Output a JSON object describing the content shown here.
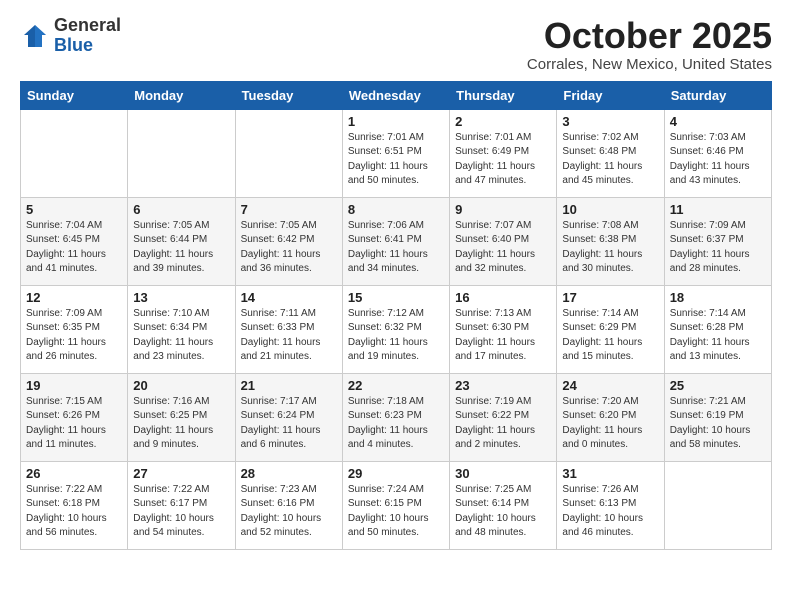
{
  "logo": {
    "general": "General",
    "blue": "Blue"
  },
  "header": {
    "month": "October 2025",
    "location": "Corrales, New Mexico, United States"
  },
  "weekdays": [
    "Sunday",
    "Monday",
    "Tuesday",
    "Wednesday",
    "Thursday",
    "Friday",
    "Saturday"
  ],
  "weeks": [
    [
      {
        "day": "",
        "info": ""
      },
      {
        "day": "",
        "info": ""
      },
      {
        "day": "",
        "info": ""
      },
      {
        "day": "1",
        "info": "Sunrise: 7:01 AM\nSunset: 6:51 PM\nDaylight: 11 hours\nand 50 minutes."
      },
      {
        "day": "2",
        "info": "Sunrise: 7:01 AM\nSunset: 6:49 PM\nDaylight: 11 hours\nand 47 minutes."
      },
      {
        "day": "3",
        "info": "Sunrise: 7:02 AM\nSunset: 6:48 PM\nDaylight: 11 hours\nand 45 minutes."
      },
      {
        "day": "4",
        "info": "Sunrise: 7:03 AM\nSunset: 6:46 PM\nDaylight: 11 hours\nand 43 minutes."
      }
    ],
    [
      {
        "day": "5",
        "info": "Sunrise: 7:04 AM\nSunset: 6:45 PM\nDaylight: 11 hours\nand 41 minutes."
      },
      {
        "day": "6",
        "info": "Sunrise: 7:05 AM\nSunset: 6:44 PM\nDaylight: 11 hours\nand 39 minutes."
      },
      {
        "day": "7",
        "info": "Sunrise: 7:05 AM\nSunset: 6:42 PM\nDaylight: 11 hours\nand 36 minutes."
      },
      {
        "day": "8",
        "info": "Sunrise: 7:06 AM\nSunset: 6:41 PM\nDaylight: 11 hours\nand 34 minutes."
      },
      {
        "day": "9",
        "info": "Sunrise: 7:07 AM\nSunset: 6:40 PM\nDaylight: 11 hours\nand 32 minutes."
      },
      {
        "day": "10",
        "info": "Sunrise: 7:08 AM\nSunset: 6:38 PM\nDaylight: 11 hours\nand 30 minutes."
      },
      {
        "day": "11",
        "info": "Sunrise: 7:09 AM\nSunset: 6:37 PM\nDaylight: 11 hours\nand 28 minutes."
      }
    ],
    [
      {
        "day": "12",
        "info": "Sunrise: 7:09 AM\nSunset: 6:35 PM\nDaylight: 11 hours\nand 26 minutes."
      },
      {
        "day": "13",
        "info": "Sunrise: 7:10 AM\nSunset: 6:34 PM\nDaylight: 11 hours\nand 23 minutes."
      },
      {
        "day": "14",
        "info": "Sunrise: 7:11 AM\nSunset: 6:33 PM\nDaylight: 11 hours\nand 21 minutes."
      },
      {
        "day": "15",
        "info": "Sunrise: 7:12 AM\nSunset: 6:32 PM\nDaylight: 11 hours\nand 19 minutes."
      },
      {
        "day": "16",
        "info": "Sunrise: 7:13 AM\nSunset: 6:30 PM\nDaylight: 11 hours\nand 17 minutes."
      },
      {
        "day": "17",
        "info": "Sunrise: 7:14 AM\nSunset: 6:29 PM\nDaylight: 11 hours\nand 15 minutes."
      },
      {
        "day": "18",
        "info": "Sunrise: 7:14 AM\nSunset: 6:28 PM\nDaylight: 11 hours\nand 13 minutes."
      }
    ],
    [
      {
        "day": "19",
        "info": "Sunrise: 7:15 AM\nSunset: 6:26 PM\nDaylight: 11 hours\nand 11 minutes."
      },
      {
        "day": "20",
        "info": "Sunrise: 7:16 AM\nSunset: 6:25 PM\nDaylight: 11 hours\nand 9 minutes."
      },
      {
        "day": "21",
        "info": "Sunrise: 7:17 AM\nSunset: 6:24 PM\nDaylight: 11 hours\nand 6 minutes."
      },
      {
        "day": "22",
        "info": "Sunrise: 7:18 AM\nSunset: 6:23 PM\nDaylight: 11 hours\nand 4 minutes."
      },
      {
        "day": "23",
        "info": "Sunrise: 7:19 AM\nSunset: 6:22 PM\nDaylight: 11 hours\nand 2 minutes."
      },
      {
        "day": "24",
        "info": "Sunrise: 7:20 AM\nSunset: 6:20 PM\nDaylight: 11 hours\nand 0 minutes."
      },
      {
        "day": "25",
        "info": "Sunrise: 7:21 AM\nSunset: 6:19 PM\nDaylight: 10 hours\nand 58 minutes."
      }
    ],
    [
      {
        "day": "26",
        "info": "Sunrise: 7:22 AM\nSunset: 6:18 PM\nDaylight: 10 hours\nand 56 minutes."
      },
      {
        "day": "27",
        "info": "Sunrise: 7:22 AM\nSunset: 6:17 PM\nDaylight: 10 hours\nand 54 minutes."
      },
      {
        "day": "28",
        "info": "Sunrise: 7:23 AM\nSunset: 6:16 PM\nDaylight: 10 hours\nand 52 minutes."
      },
      {
        "day": "29",
        "info": "Sunrise: 7:24 AM\nSunset: 6:15 PM\nDaylight: 10 hours\nand 50 minutes."
      },
      {
        "day": "30",
        "info": "Sunrise: 7:25 AM\nSunset: 6:14 PM\nDaylight: 10 hours\nand 48 minutes."
      },
      {
        "day": "31",
        "info": "Sunrise: 7:26 AM\nSunset: 6:13 PM\nDaylight: 10 hours\nand 46 minutes."
      },
      {
        "day": "",
        "info": ""
      }
    ]
  ]
}
